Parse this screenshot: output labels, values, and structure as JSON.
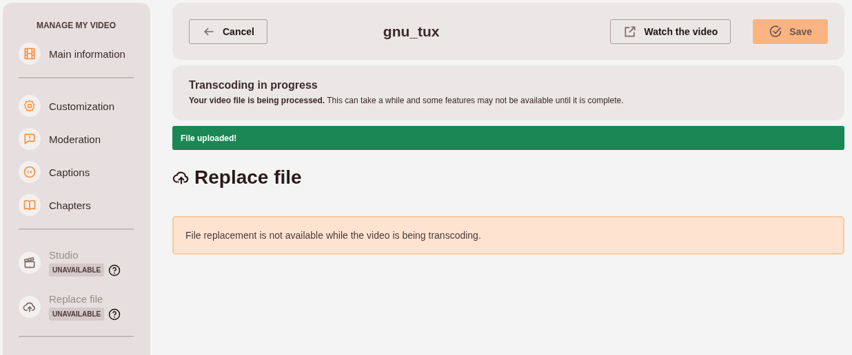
{
  "sidebar": {
    "title": "MANAGE MY VIDEO",
    "groups": [
      {
        "items": [
          {
            "label": "Main information",
            "disabled": false
          }
        ]
      },
      {
        "items": [
          {
            "label": "Customization",
            "disabled": false
          },
          {
            "label": "Moderation",
            "disabled": false
          },
          {
            "label": "Captions",
            "disabled": false
          },
          {
            "label": "Chapters",
            "disabled": false
          }
        ]
      },
      {
        "items": [
          {
            "label": "Studio",
            "disabled": true,
            "badge": "UNAVAILABLE"
          },
          {
            "label": "Replace file",
            "disabled": true,
            "badge": "UNAVAILABLE"
          }
        ]
      }
    ]
  },
  "header": {
    "cancel": "Cancel",
    "title": "gnu_tux",
    "watch": "Watch the video",
    "save": {
      "label": "Save",
      "disabled": true
    }
  },
  "notice": {
    "title": "Transcoding in progress",
    "text": "**Your video file is being processed.** This can take a while and some features may not be available until it is complete."
  },
  "success": "File uploaded!",
  "heading": "Replace file",
  "warning": "File replacement is not available while the video is being transcoding."
}
